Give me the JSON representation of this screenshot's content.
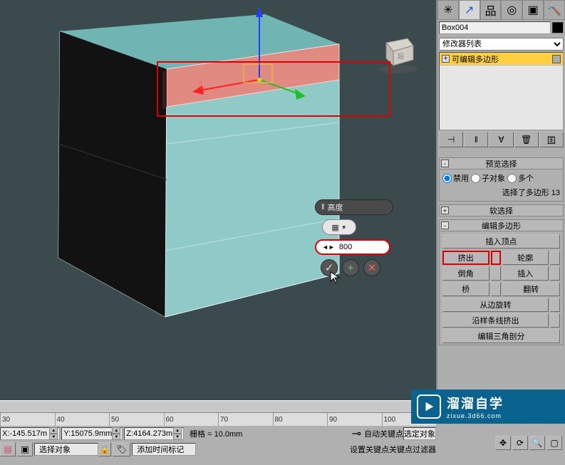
{
  "object_name": "Box004",
  "modifier_list_label": "修改器列表",
  "stack_item": "可编辑多边形",
  "rollouts": {
    "preview_sel": {
      "title": "预览选择",
      "disable": "禁用",
      "subobj": "子对象",
      "multi": "多个",
      "sel_info": "选择了多边形 13"
    },
    "soft_sel": "软选择",
    "edit_poly": "编辑多边形",
    "insert_vertex": "插入顶点",
    "buttons": {
      "extrude": "挤出",
      "outline": "轮廓",
      "bevel": "倒角",
      "inset": "插入",
      "bridge": "桥",
      "flip": "翻转",
      "hinge": "从边旋转",
      "extrude_along_spline": "沿样条线挤出",
      "edit_tri": "编辑三角剖分"
    }
  },
  "caddy": {
    "title": "高度",
    "value": "800"
  },
  "coords": {
    "x_label": "X:",
    "x_val": "-145.517m",
    "y_label": "Y:",
    "y_val": "15075.9mm",
    "z_label": "Z:",
    "z_val": "4164.273m",
    "grid": "栅格 = 10.0mm"
  },
  "ticks": [
    "30",
    "40",
    "50",
    "60",
    "70",
    "80",
    "90",
    "100"
  ],
  "bottom": {
    "sel_obj": "选择对象",
    "add_time_tag": "添加时间标记",
    "auto_key": "自动关键点",
    "set_key": "设置关键点",
    "sel_target": "选定对象",
    "key_filter": "关键点过滤器"
  },
  "watermark": {
    "main": "溜溜自学",
    "sub": "zixue.3d66.com"
  },
  "icons": {
    "pin": "📌",
    "check": "✓",
    "plus": "+",
    "cross": "✕",
    "lock": "🔒",
    "key": "⊸"
  }
}
